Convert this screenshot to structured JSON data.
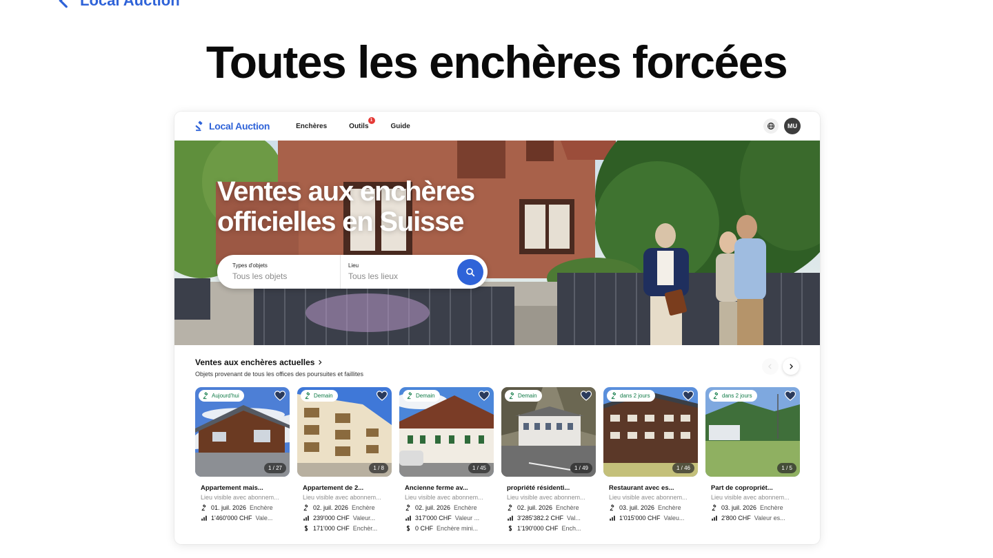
{
  "top_link": {
    "label": "Local Auction"
  },
  "headline": "Toutes les enchères forcées",
  "app": {
    "brand": "Local Auction",
    "menu": [
      {
        "label": "Enchères"
      },
      {
        "label": "Outils",
        "badge": "1"
      },
      {
        "label": "Guide"
      }
    ],
    "avatar": "MU",
    "hero": {
      "title": "Ventes aux enchères officielles en Suisse",
      "search": {
        "type_label": "Types d'objets",
        "type_value": "Tous les objets",
        "place_label": "Lieu",
        "place_value": "Tous les lieux"
      }
    },
    "section": {
      "title": "Ventes aux enchères actuelles",
      "subtitle": "Objets provenant de tous les offices des poursuites et faillites"
    },
    "colors": {
      "accent": "#2f63d8",
      "badge_green": "#0f7a46"
    },
    "listings": [
      {
        "tag": "Aujourd'hui",
        "counter": "1 / 27",
        "title": "Appartement mais...",
        "location": "Lieu visible avec abonnem...",
        "date": "01. juil. 2026",
        "date_type": "Enchère",
        "value": "1'460'000 CHF",
        "value_type": "Vale...",
        "min": "",
        "min_type": ""
      },
      {
        "tag": "Demain",
        "counter": "1 / 8",
        "title": "Appartement de 2...",
        "location": "Lieu visible avec abonnem...",
        "date": "02. juil. 2026",
        "date_type": "Enchère",
        "value": "239'000 CHF",
        "value_type": "Valeur...",
        "min": "171'000 CHF",
        "min_type": "Enchèr..."
      },
      {
        "tag": "Demain",
        "counter": "1 / 45",
        "title": "Ancienne ferme av...",
        "location": "Lieu visible avec abonnem...",
        "date": "02. juil. 2026",
        "date_type": "Enchère",
        "value": "317'000 CHF",
        "value_type": "Valeur ...",
        "min": "0 CHF",
        "min_type": "Enchère mini..."
      },
      {
        "tag": "Demain",
        "counter": "1 / 49",
        "title": "propriété résidenti...",
        "location": "Lieu visible avec abonnem...",
        "date": "02. juil. 2026",
        "date_type": "Enchère",
        "value": "3'285'382.2 CHF",
        "value_type": "Val...",
        "min": "1'190'000 CHF",
        "min_type": "Ench..."
      },
      {
        "tag": "dans 2 jours",
        "counter": "1 / 46",
        "title": "Restaurant avec es...",
        "location": "Lieu visible avec abonnem...",
        "date": "03. juil. 2026",
        "date_type": "Enchère",
        "value": "1'015'000 CHF",
        "value_type": "Valeu...",
        "min": "",
        "min_type": ""
      },
      {
        "tag": "dans 2 jours",
        "counter": "1 / 5",
        "title": "Part de copropriét...",
        "location": "Lieu visible avec abonnem...",
        "date": "03. juil. 2026",
        "date_type": "Enchère",
        "value": "2'800 CHF",
        "value_type": "Valeur es...",
        "min": "",
        "min_type": ""
      }
    ]
  }
}
